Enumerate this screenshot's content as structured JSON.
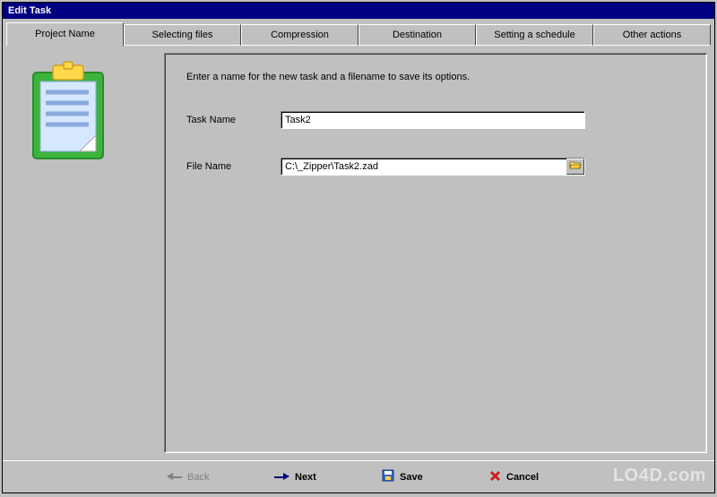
{
  "window": {
    "title": "Edit Task"
  },
  "tabs": [
    {
      "label": "Project Name"
    },
    {
      "label": "Selecting files"
    },
    {
      "label": "Compression"
    },
    {
      "label": "Destination"
    },
    {
      "label": "Setting a schedule"
    },
    {
      "label": "Other actions"
    }
  ],
  "panel": {
    "instruction": "Enter a name for the new task and a filename to save its options.",
    "task_name_label": "Task Name",
    "task_name_value": "Task2",
    "file_name_label": "File Name",
    "file_name_value": "C:\\_Zipper\\Task2.zad"
  },
  "buttons": {
    "back": "Back",
    "next": "Next",
    "save": "Save",
    "cancel": "Cancel"
  },
  "watermark": "LO4D.com"
}
